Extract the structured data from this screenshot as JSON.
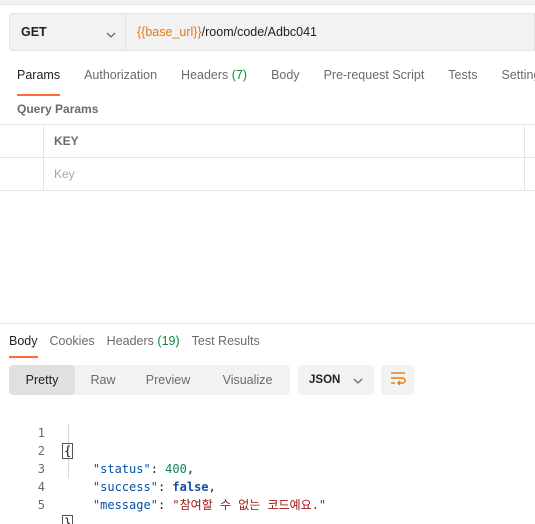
{
  "request": {
    "method": "GET",
    "url_variable": "{{base_url}}",
    "url_path": "/room/code/Adbc041"
  },
  "request_tabs": [
    {
      "label": "Params",
      "count": ""
    },
    {
      "label": "Authorization",
      "count": ""
    },
    {
      "label": "Headers",
      "count": "(7)"
    },
    {
      "label": "Body",
      "count": ""
    },
    {
      "label": "Pre-request Script",
      "count": ""
    },
    {
      "label": "Tests",
      "count": ""
    },
    {
      "label": "Settings",
      "count": ""
    }
  ],
  "query_params": {
    "title": "Query Params",
    "key_header": "KEY",
    "key_placeholder": "Key"
  },
  "response_tabs": [
    {
      "label": "Body",
      "count": ""
    },
    {
      "label": "Cookies",
      "count": ""
    },
    {
      "label": "Headers",
      "count": "(19)"
    },
    {
      "label": "Test Results",
      "count": ""
    }
  ],
  "view_modes": [
    "Pretty",
    "Raw",
    "Preview",
    "Visualize"
  ],
  "format": "JSON",
  "body": {
    "line_numbers": [
      "1",
      "2",
      "3",
      "4",
      "5"
    ],
    "open_brace": "{",
    "close_brace": "}",
    "status_key": "\"status\"",
    "status_value": "400",
    "success_key": "\"success\"",
    "success_value": "false",
    "message_key": "\"message\"",
    "message_value": "\"참여할 수 없는 코드예요.\""
  },
  "colors": {
    "accent": "#ff6c37",
    "variable": "#e8790f",
    "count": "#0c8a3c"
  },
  "icons": [
    "chevron-down-icon",
    "wrap-lines-icon"
  ]
}
